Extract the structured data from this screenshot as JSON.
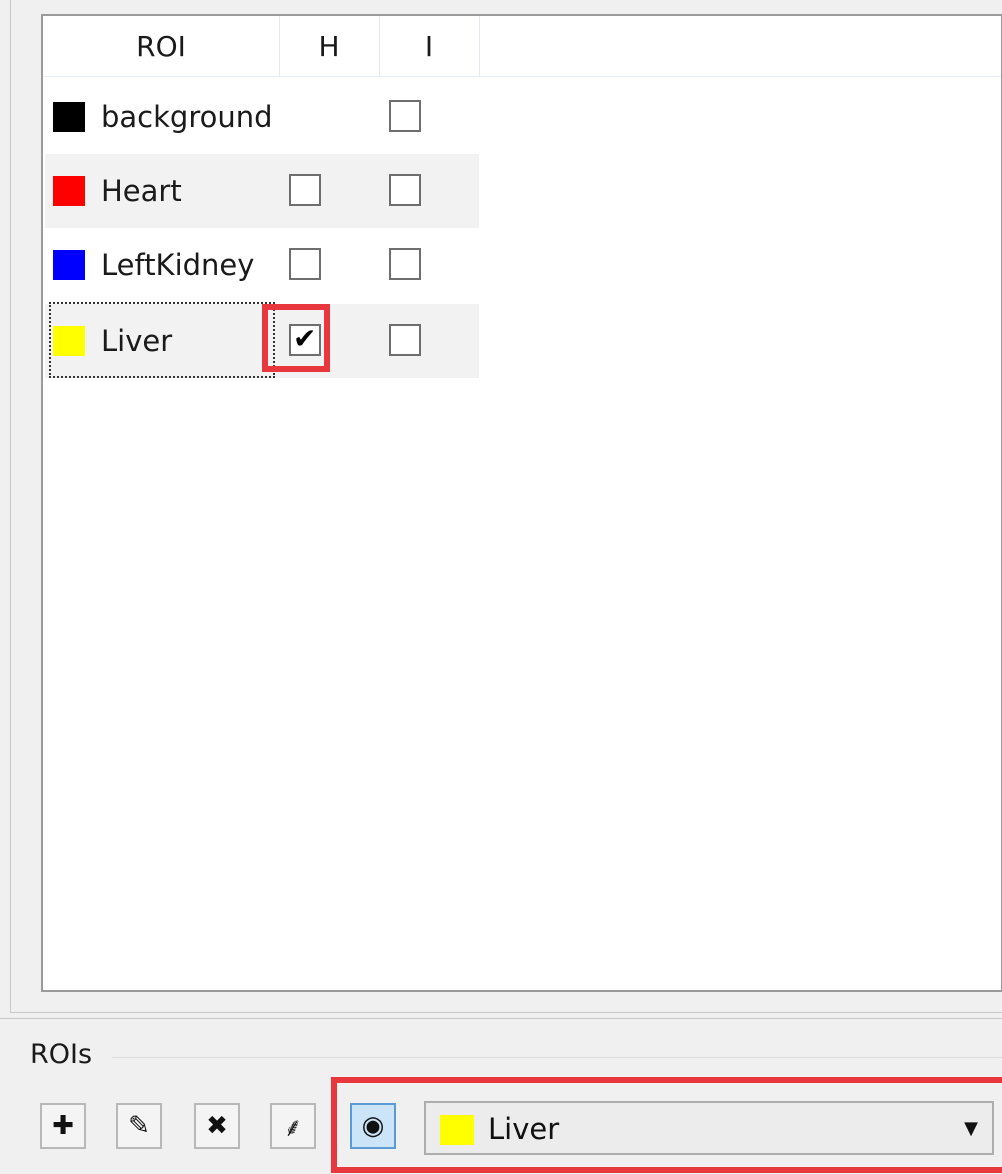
{
  "table": {
    "columns": [
      "ROI",
      "H",
      "I"
    ],
    "rows": [
      {
        "name": "background",
        "color": "#000000",
        "has_h": false,
        "h": false,
        "i": false
      },
      {
        "name": "Heart",
        "color": "#ff0000",
        "has_h": true,
        "h": false,
        "i": false
      },
      {
        "name": "LeftKidney",
        "color": "#0000ff",
        "has_h": true,
        "h": false,
        "i": false
      },
      {
        "name": "Liver",
        "color": "#ffff00",
        "has_h": true,
        "h": true,
        "i": false,
        "focused": true
      }
    ]
  },
  "group": {
    "label": "ROIs",
    "buttons": [
      {
        "icon": "plus-icon",
        "glyph": "✚"
      },
      {
        "icon": "pencil-icon",
        "glyph": "✎"
      },
      {
        "icon": "delete-x-icon",
        "glyph": "✖"
      },
      {
        "icon": "brush-icon",
        "glyph": "⸙"
      },
      {
        "icon": "eye-icon",
        "glyph": "◉",
        "active": true
      }
    ],
    "selector": {
      "value": "Liver",
      "color": "#ffff00",
      "arrow": "▼"
    }
  },
  "highlight_color": "#e8383d"
}
